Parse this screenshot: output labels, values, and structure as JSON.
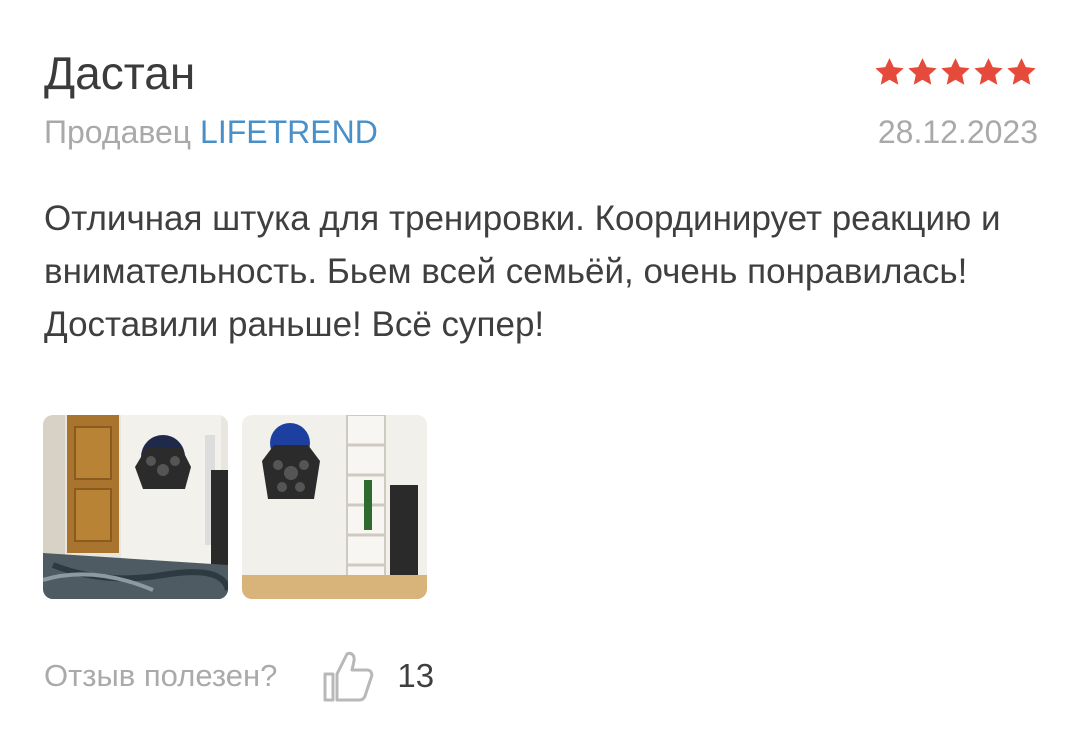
{
  "review": {
    "author": "Дастан",
    "rating": 5,
    "seller_label": "Продавец",
    "seller_name": "LIFETREND",
    "date": "28.12.2023",
    "text": "Отличная штука для тренировки. Координирует реакцию и внимательность. Бьем всей семьёй, очень понравилась! Доставили раньше! Всё супер!"
  },
  "colors": {
    "star": "#e64a3b",
    "seller_link": "#4a90c8",
    "muted": "#a9a9a9"
  },
  "footer": {
    "helpful_label": "Отзыв полезен?",
    "like_icon": "thumbs-up-icon",
    "like_count": "13"
  }
}
